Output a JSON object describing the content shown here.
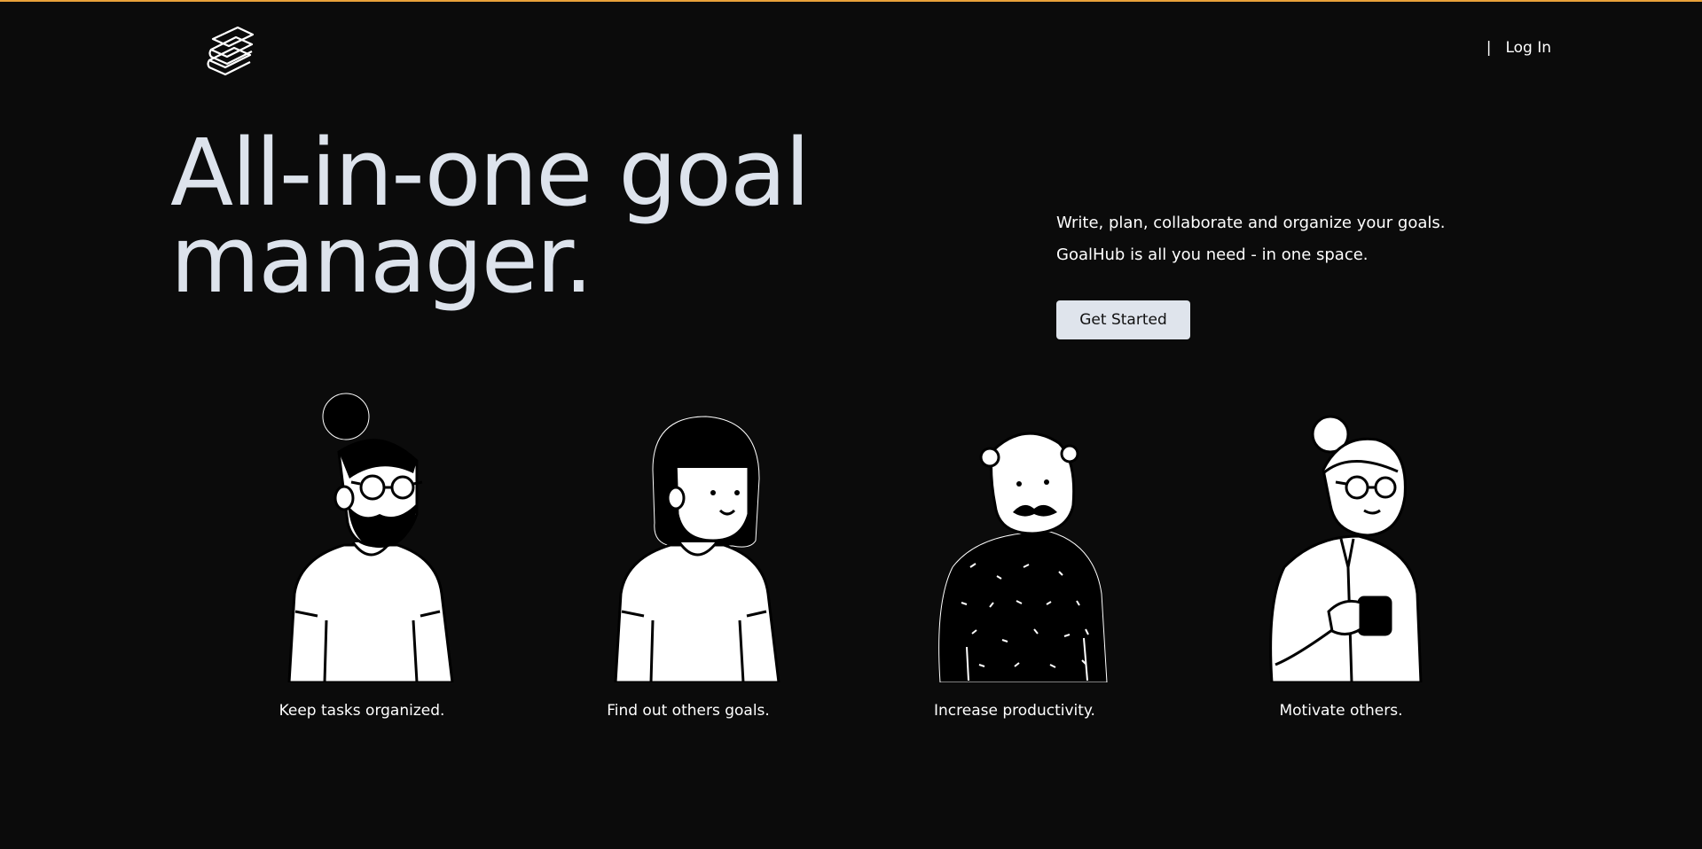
{
  "header": {
    "logo_icon": "stacked-books-icon",
    "nav": {
      "separator": "|",
      "login_label": "Log In"
    }
  },
  "hero": {
    "title_line_1": "All-in-one goal",
    "title_line_2": "manager.",
    "description_line_1": "Write, plan, collaborate and organize your goals.",
    "description_line_2": "GoalHub is all you need - in one space.",
    "cta_label": "Get Started"
  },
  "features": [
    {
      "illustration": "bearded-man-illustration",
      "caption": "Keep tasks organized."
    },
    {
      "illustration": "woman-with-bangs-illustration",
      "caption": "Find out others goals."
    },
    {
      "illustration": "bald-man-illustration",
      "caption": "Increase productivity."
    },
    {
      "illustration": "woman-with-mug-illustration",
      "caption": "Motivate others."
    }
  ],
  "colors": {
    "background": "#0b0b0b",
    "accent_line": "#e8a13a",
    "title": "#dde3ec",
    "button": "#dfe4ec"
  }
}
